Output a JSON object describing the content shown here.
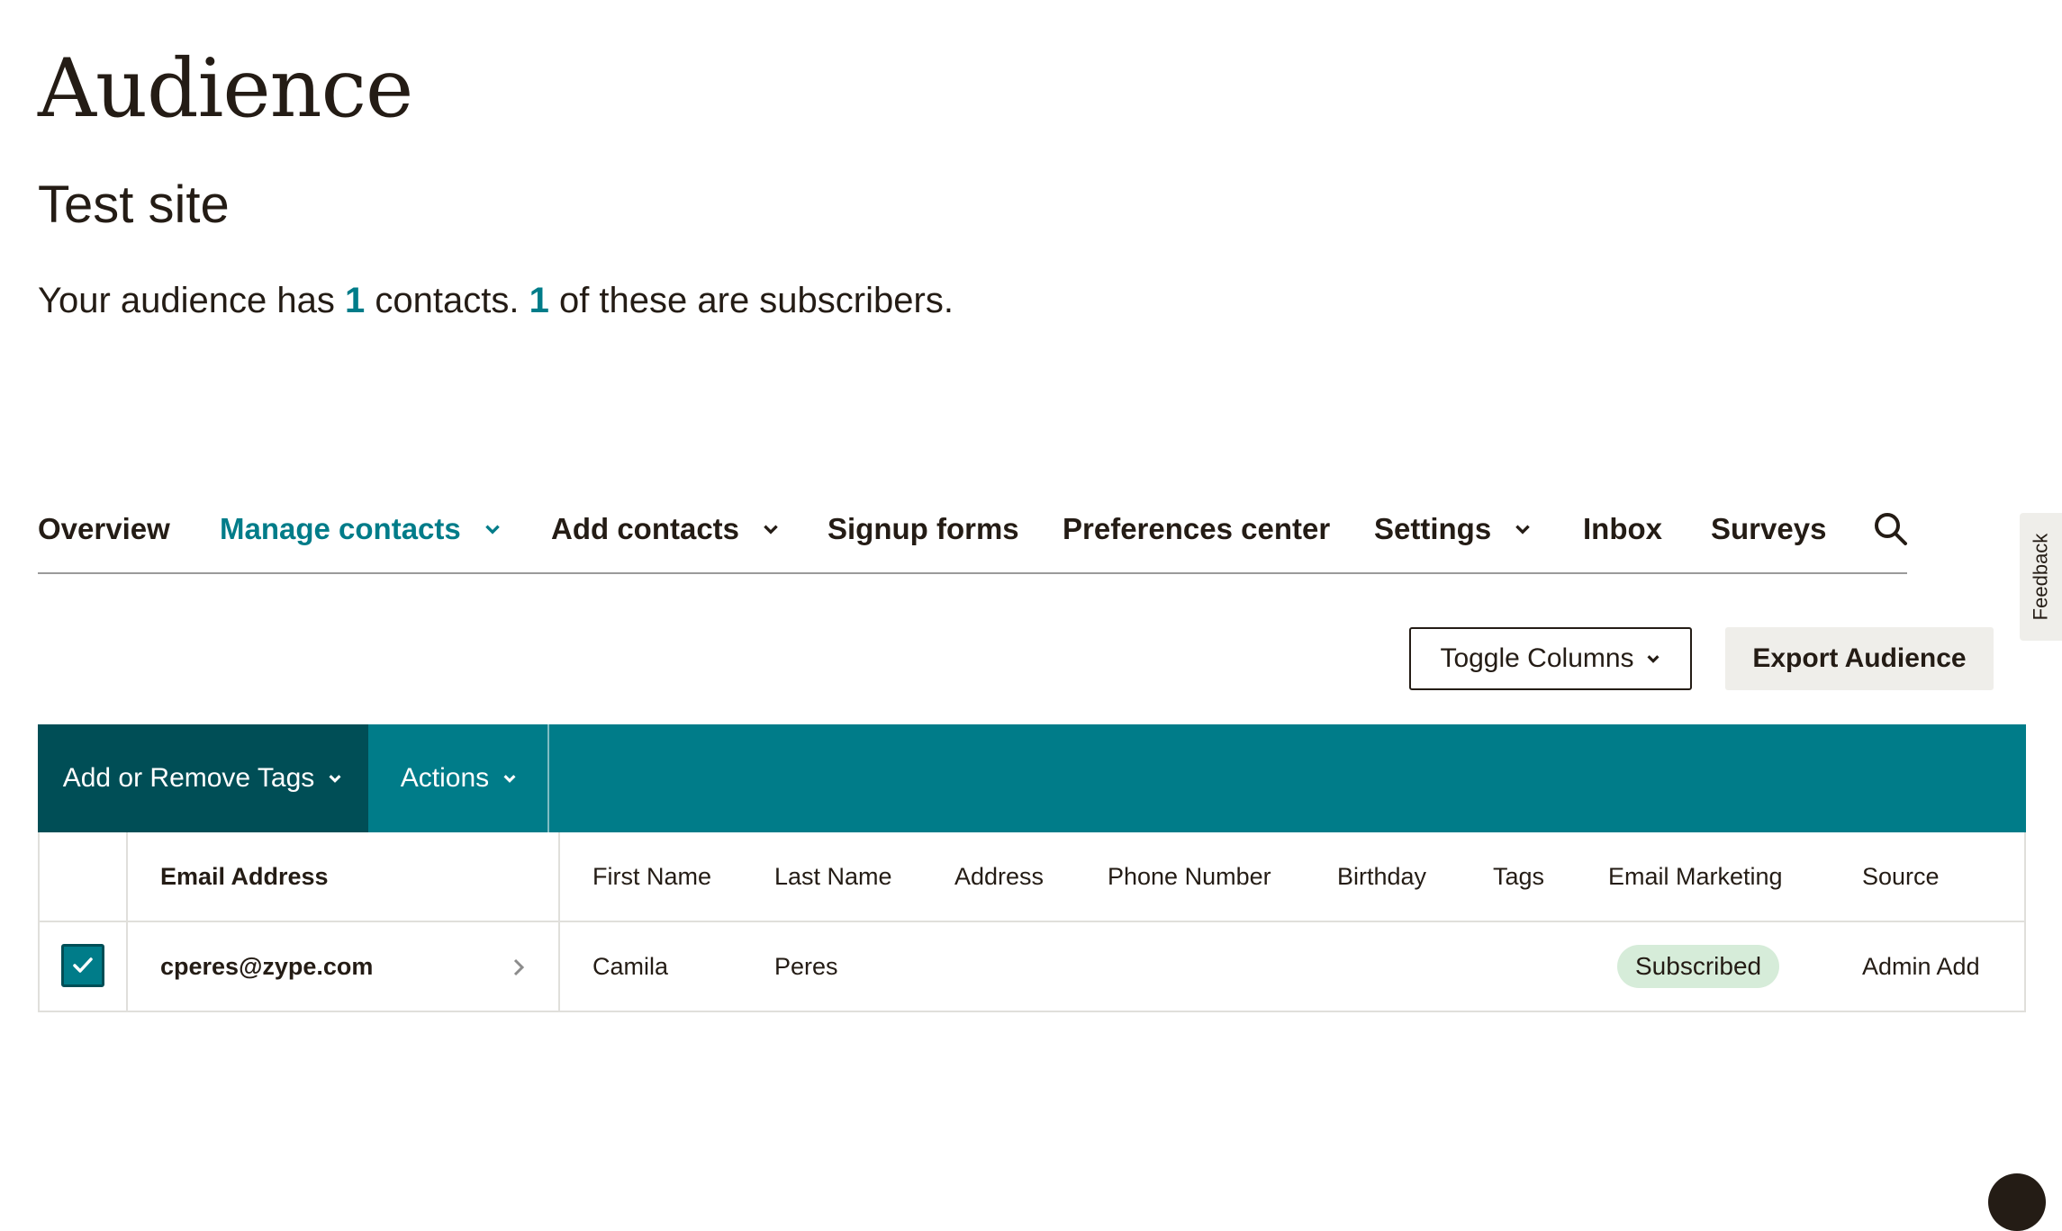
{
  "header": {
    "title": "Audience",
    "site_name": "Test site",
    "summary": {
      "part1": "Your audience has ",
      "contacts_count": "1",
      "part2": " contacts. ",
      "subscribers_count": "1",
      "part3": " of these are subscribers."
    }
  },
  "nav": {
    "tabs": [
      {
        "label": "Overview",
        "active": false,
        "dropdown": false
      },
      {
        "label": "Manage contacts",
        "active": true,
        "dropdown": true
      },
      {
        "label": "Add contacts",
        "active": false,
        "dropdown": true
      },
      {
        "label": "Signup forms",
        "active": false,
        "dropdown": false
      },
      {
        "label": "Preferences center",
        "active": false,
        "dropdown": false
      },
      {
        "label": "Settings",
        "active": false,
        "dropdown": true
      },
      {
        "label": "Inbox",
        "active": false,
        "dropdown": false
      },
      {
        "label": "Surveys",
        "active": false,
        "dropdown": false
      }
    ],
    "search_icon": "search-icon"
  },
  "feedback_label": "Feedback",
  "toolbar": {
    "toggle_columns_label": "Toggle Columns",
    "export_label": "Export Audience"
  },
  "action_bar": {
    "tags_label": "Add or Remove Tags",
    "actions_label": "Actions"
  },
  "table": {
    "columns": [
      "Email Address",
      "First Name",
      "Last Name",
      "Address",
      "Phone Number",
      "Birthday",
      "Tags",
      "Email Marketing",
      "Source"
    ],
    "rows": [
      {
        "checked": true,
        "email": "cperes@zype.com",
        "first_name": "Camila",
        "last_name": "Peres",
        "address": "",
        "phone": "",
        "birthday": "",
        "tags": "",
        "email_marketing": "Subscribed",
        "source": "Admin Add"
      }
    ]
  },
  "colors": {
    "accent": "#007c89",
    "accent_dark": "#004e56",
    "text": "#241c15",
    "badge_bg": "#d6ecd9",
    "neutral_bg": "#efeeea"
  }
}
